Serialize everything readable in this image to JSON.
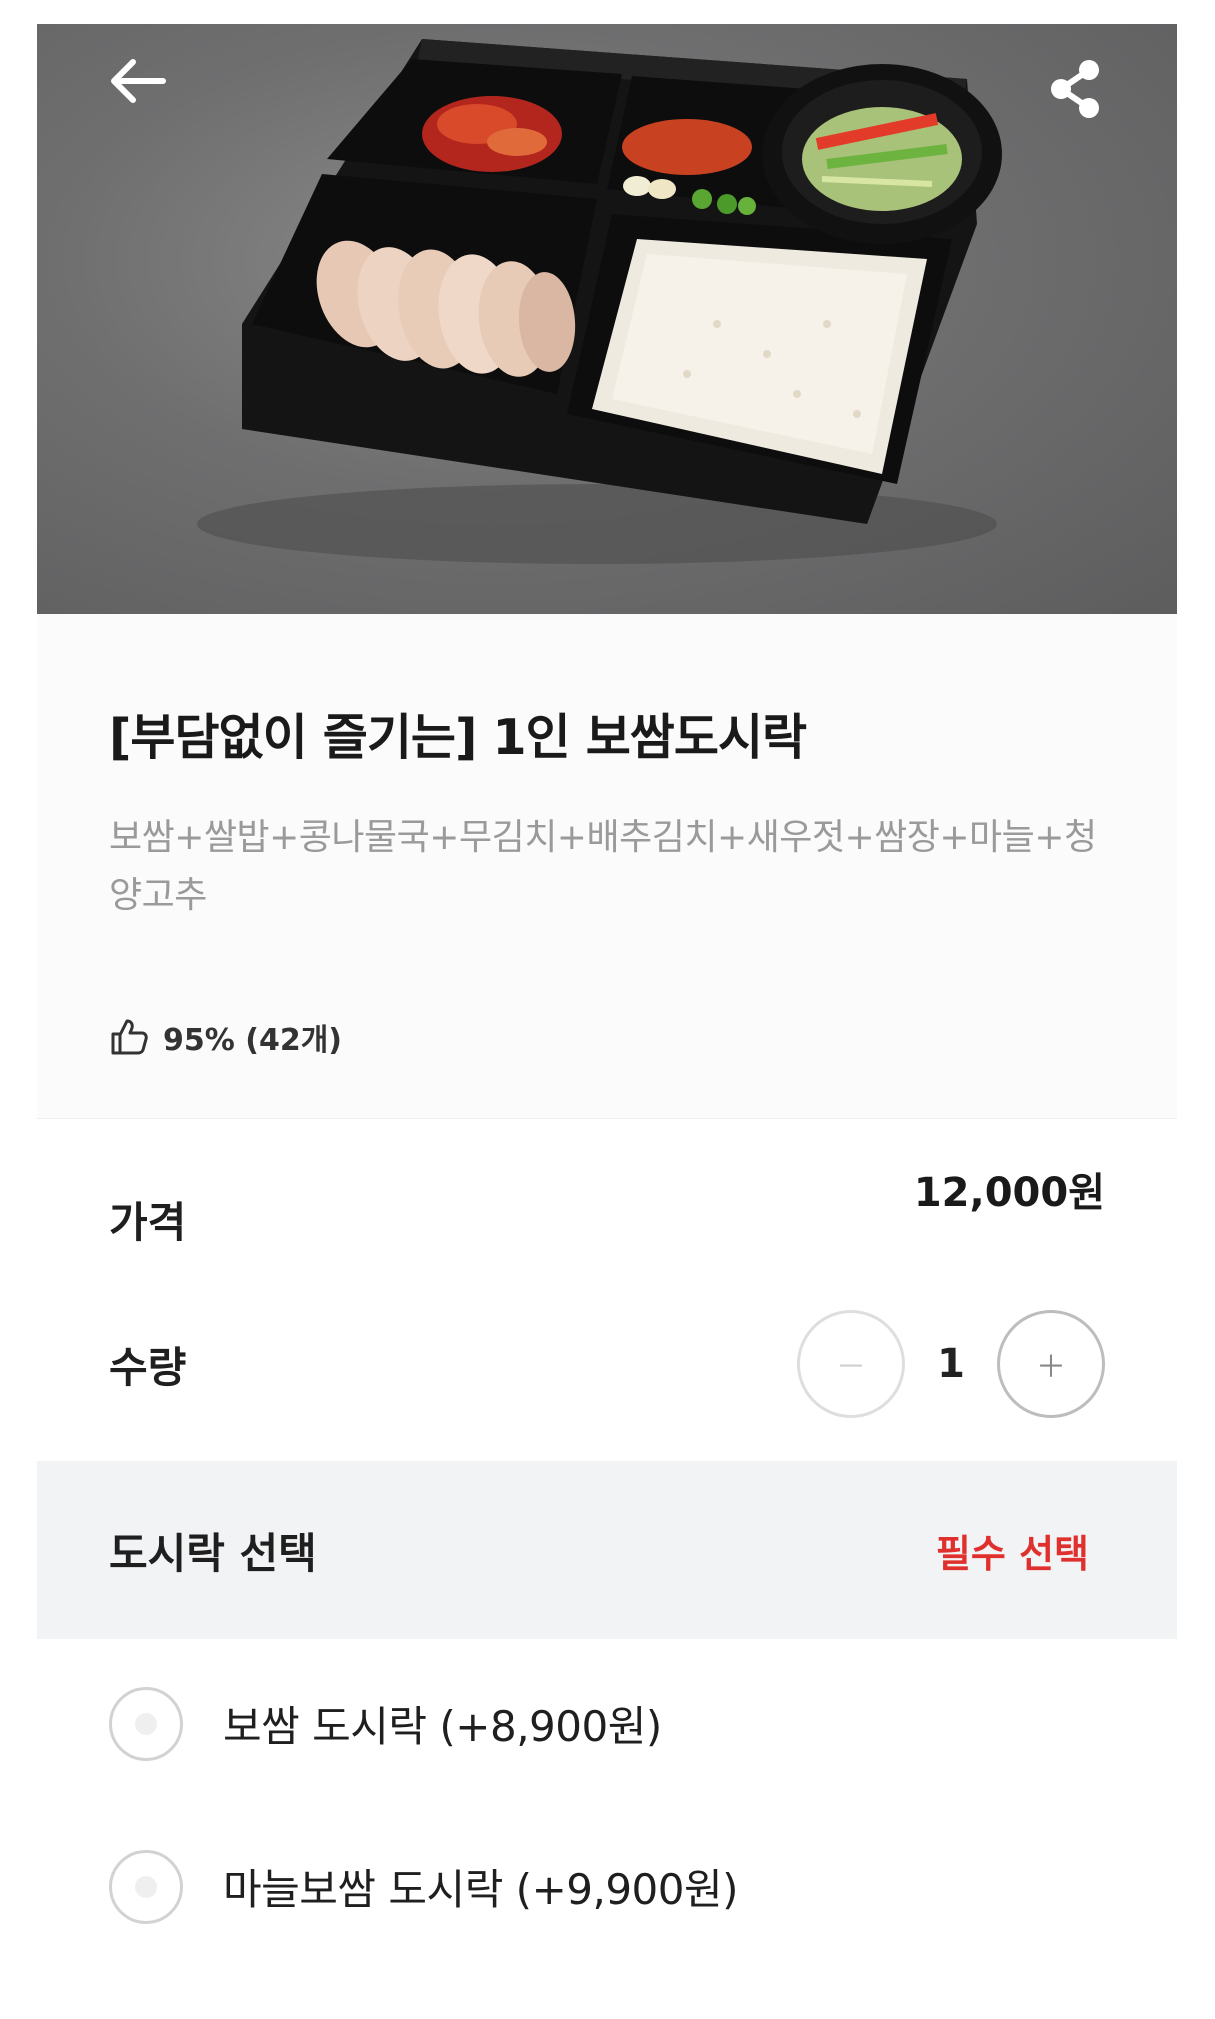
{
  "header": {
    "back_icon": "arrow-left-icon",
    "share_icon": "share-icon"
  },
  "product": {
    "title": "[부담없이 즐기는] 1인 보쌈도시락",
    "description": "보쌈+쌀밥+콩나물국+무김치+배추김치+새우젓+쌈장+마늘+청양고추",
    "rating_icon": "thumbs-up-icon",
    "rating": "95% (42개)"
  },
  "price": {
    "label": "가격",
    "value": "12,000원"
  },
  "quantity": {
    "label": "수량",
    "minus_label": "－",
    "plus_label": "＋",
    "value": "1"
  },
  "options": {
    "title": "도시락 선택",
    "required": "필수 선택",
    "items": [
      {
        "label": "보쌈 도시락 (+8,900원)"
      },
      {
        "label": "마늘보쌈 도시락 (+9,900원)"
      }
    ]
  },
  "colors": {
    "accent_required": "#e0302e",
    "section_bg": "#f2f3f5"
  }
}
